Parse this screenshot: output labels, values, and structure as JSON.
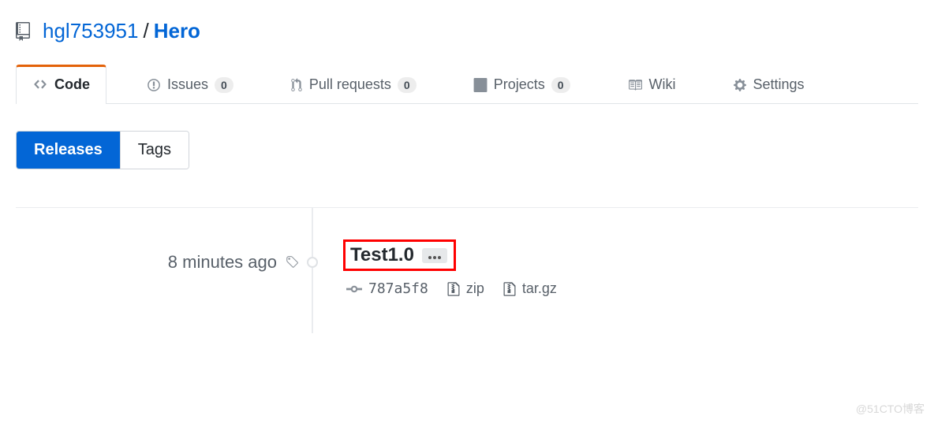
{
  "repo": {
    "owner": "hgl753951",
    "name": "Hero",
    "separator": "/"
  },
  "tabs": [
    {
      "label": "Code",
      "selected": true
    },
    {
      "label": "Issues",
      "count": "0"
    },
    {
      "label": "Pull requests",
      "count": "0"
    },
    {
      "label": "Projects",
      "count": "0"
    },
    {
      "label": "Wiki"
    },
    {
      "label": "Settings"
    }
  ],
  "subnav": {
    "releases": "Releases",
    "tags": "Tags"
  },
  "release": {
    "timestamp": "8 minutes ago",
    "title": "Test1.0",
    "commit_sha": "787a5f8",
    "assets": {
      "zip": "zip",
      "targz": "tar.gz"
    }
  },
  "watermark": "@51CTO博客"
}
